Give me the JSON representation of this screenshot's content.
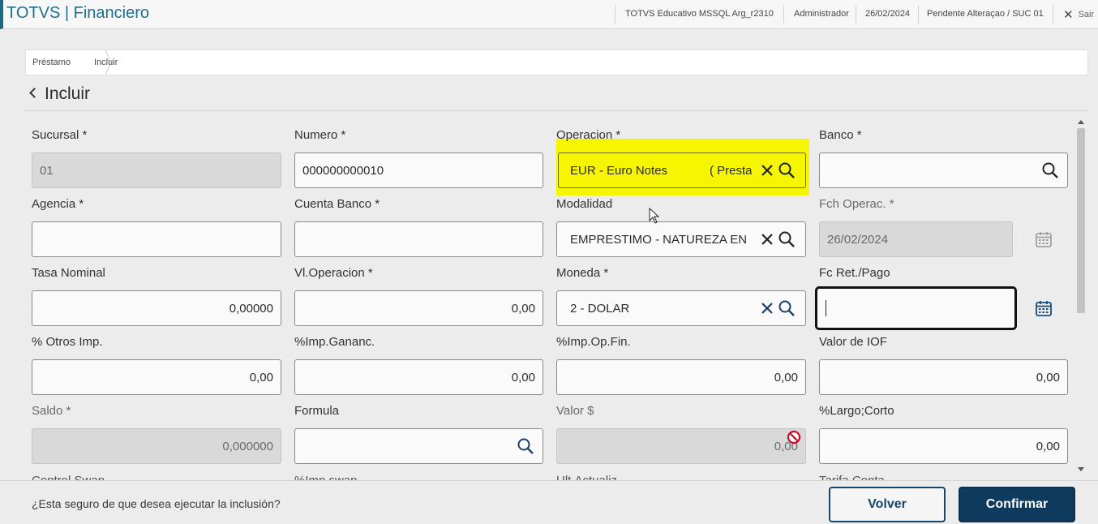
{
  "header": {
    "app_title": "TOTVS | Financiero",
    "environment": "TOTVS Educativo MSSQL Arg_r2310",
    "user": "Administrador",
    "date": "26/02/2024",
    "status": "Pendente Alteraçao / SUC 01",
    "exit_label": "Sair"
  },
  "breadcrumb": {
    "items": [
      "Préstamo",
      "Incluir"
    ]
  },
  "page": {
    "title": "Incluir"
  },
  "form": {
    "sucursal": {
      "label": "Sucursal *",
      "value": "01"
    },
    "numero": {
      "label": "Numero *",
      "value": "000000000010"
    },
    "operacion": {
      "label": "Operacion *",
      "value": "EUR - Euro Notes",
      "value_suffix": "( Presta"
    },
    "banco": {
      "label": "Banco *",
      "value": ""
    },
    "agencia": {
      "label": "Agencia *",
      "value": ""
    },
    "cuenta_banco": {
      "label": "Cuenta Banco *",
      "value": ""
    },
    "modalidad": {
      "label": "Modalidad",
      "value": "EMPRESTIMO - NATUREZA EN"
    },
    "fch_operac": {
      "label": "Fch Operac. *",
      "value": "26/02/2024"
    },
    "tasa_nominal": {
      "label": "Tasa Nominal",
      "value": "0,00000"
    },
    "vl_operacion": {
      "label": "Vl.Operacion *",
      "value": "0,00"
    },
    "moneda": {
      "label": "Moneda *",
      "value": "2 - DOLAR"
    },
    "fc_ret_pago": {
      "label": "Fc Ret./Pago",
      "value": ""
    },
    "otros_imp": {
      "label": "% Otros Imp.",
      "value": "0,00"
    },
    "imp_gananc": {
      "label": "%Imp.Gananc.",
      "value": "0,00"
    },
    "imp_op_fin": {
      "label": "%Imp.Op.Fin.",
      "value": "0,00"
    },
    "valor_iof": {
      "label": "Valor de IOF",
      "value": "0,00"
    },
    "saldo": {
      "label": "Saldo *",
      "value": "0,000000"
    },
    "formula": {
      "label": "Formula",
      "value": ""
    },
    "valor_usd": {
      "label": "Valor $",
      "value": "0,00"
    },
    "largo_corto": {
      "label": "%Largo;Corto",
      "value": "0,00"
    },
    "next_row_labels": [
      "Control Swap",
      "%Imp.swap",
      "Ult.Actualiz.",
      "Tarifa Conta"
    ]
  },
  "footer": {
    "message": "¿Esta seguro de que desea ejecutar la inclusión?",
    "back_label": "Volver",
    "confirm_label": "Confirmar"
  },
  "colors": {
    "brand": "#1e6f8e",
    "primary_button": "#0e3a5d",
    "highlight": "#f6f600"
  }
}
